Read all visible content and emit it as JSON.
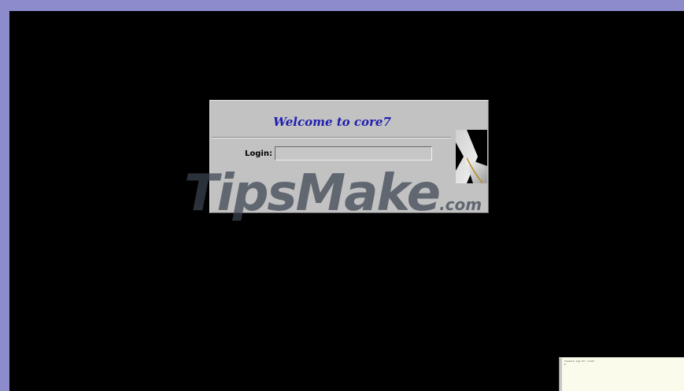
{
  "greeter": {
    "welcome": "Welcome to core7",
    "login_label": "Login:",
    "login_value": ""
  },
  "watermark": {
    "main": "TipsMake",
    "suffix": ".com"
  },
  "console": {
    "line1": "Console log for core7",
    "line2": "$"
  },
  "colors": {
    "frame": "#8c8ccc",
    "screen": "#000000",
    "greeter_bg": "#c2c2c2",
    "welcome_text": "#1f1fb0",
    "console_bg": "#fbfbeb"
  },
  "icons": {
    "logo": "kde-k-logo-icon"
  }
}
